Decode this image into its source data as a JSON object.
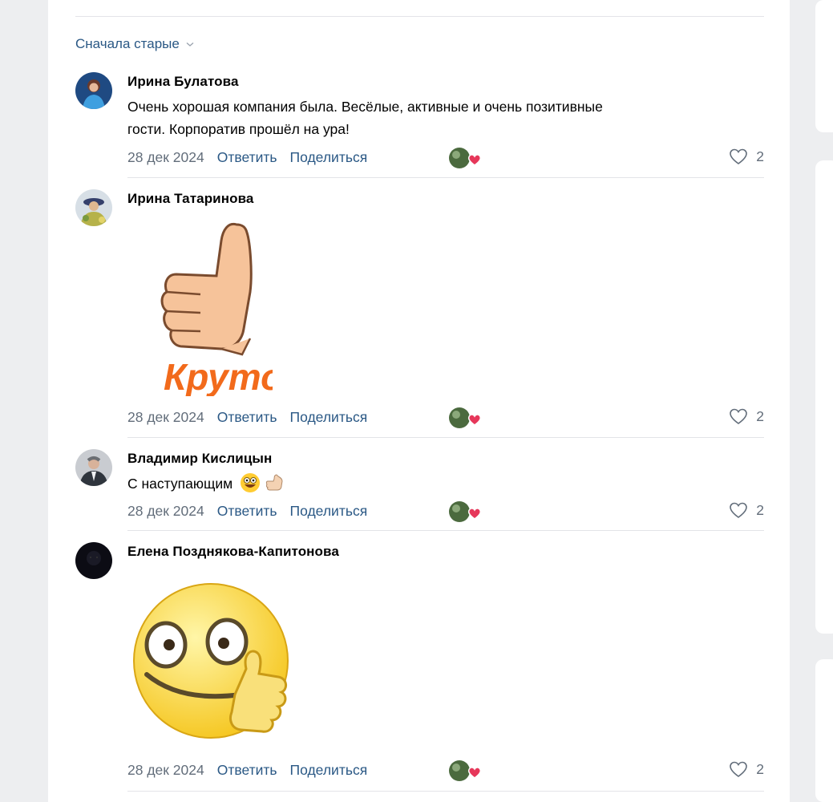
{
  "sort": {
    "label": "Сначала старые"
  },
  "comments": [
    {
      "author": "Ирина Булатова",
      "text_line1": "Очень хорошая компания была. Весёлые, активные и очень позитивные",
      "text_line2": "гости. Корпоратив прошёл на ура!",
      "date": "28 дек 2024",
      "reply": "Ответить",
      "share": "Поделиться",
      "likes": "2"
    },
    {
      "author": "Ирина Татаринова",
      "sticker_text": "Круто",
      "date": "28 дек 2024",
      "reply": "Ответить",
      "share": "Поделиться",
      "likes": "2"
    },
    {
      "author": "Владимир Кислицын",
      "text": "С наступающим",
      "date": "28 дек 2024",
      "reply": "Ответить",
      "share": "Поделиться",
      "likes": "2"
    },
    {
      "author": "Елена Позднякова-Капитонова",
      "date": "28 дек 2024",
      "reply": "Ответить",
      "share": "Поделиться",
      "likes": "2"
    }
  ],
  "icons": {
    "like": "heart-outline-icon",
    "sort": "chevron-down-icon",
    "liker_badge": "red-heart-badge"
  },
  "colors": {
    "link": "#2a5885",
    "meta": "#626d7a",
    "sticker_text": "#f26a1b",
    "heart": "#e6375a"
  }
}
